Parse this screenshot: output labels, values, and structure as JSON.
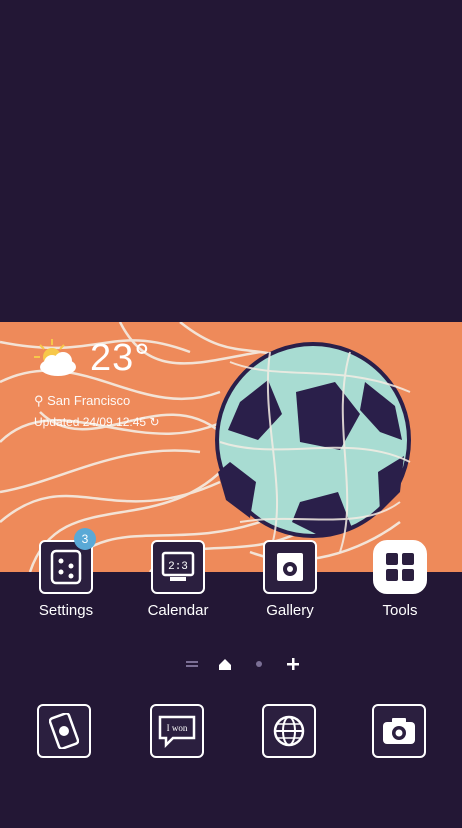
{
  "weather": {
    "temperature": "23°",
    "location": "San Francisco",
    "updated": "Updated 24/09 12:45"
  },
  "apps": [
    {
      "label": "Settings",
      "badge": "3",
      "icon": "settings-icon"
    },
    {
      "label": "Calendar",
      "icon": "calendar-icon"
    },
    {
      "label": "Gallery",
      "icon": "gallery-icon"
    },
    {
      "label": "Tools",
      "icon": "tools-icon"
    }
  ],
  "page_indicator": {
    "items": [
      "menu-icon",
      "home-icon",
      "dot",
      "add-icon"
    ]
  },
  "dock": [
    {
      "icon": "phone-icon"
    },
    {
      "icon": "messages-icon",
      "text": "I won"
    },
    {
      "icon": "internet-icon"
    },
    {
      "icon": "camera-icon"
    }
  ],
  "colors": {
    "background": "#231735",
    "banner": "#ee8a5a",
    "ball_dark": "#2a1f4a",
    "ball_light": "#a8dcd2",
    "badge": "#5aa9d6"
  }
}
